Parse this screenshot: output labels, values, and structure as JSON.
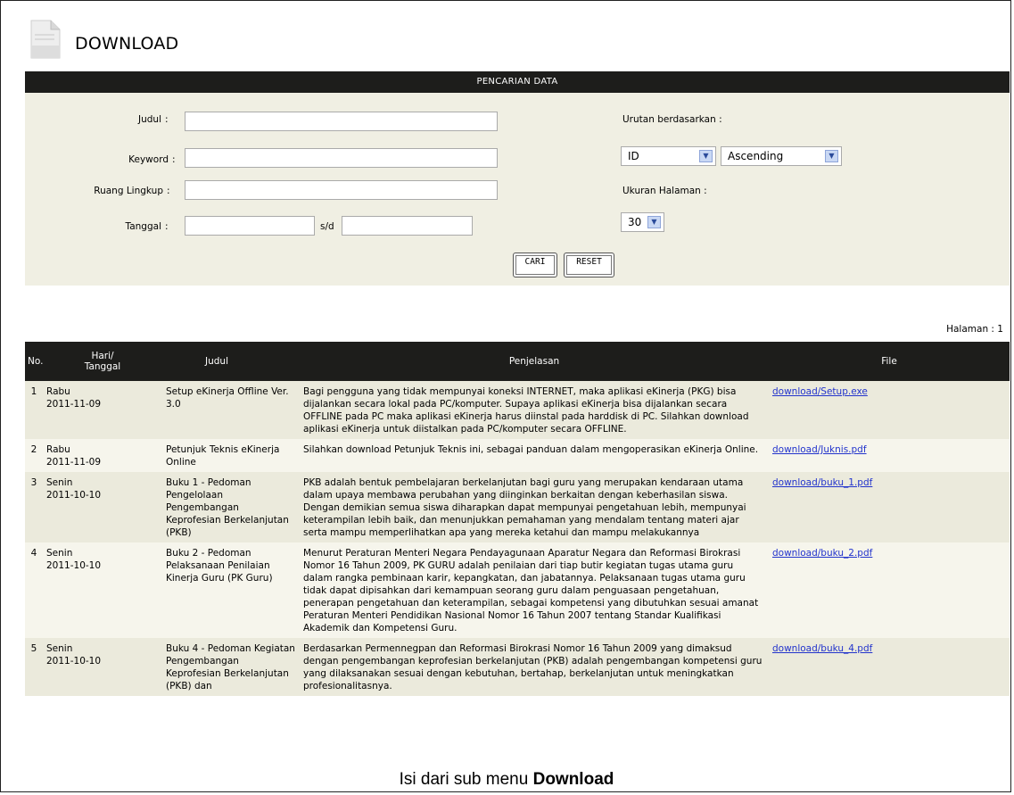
{
  "header": {
    "title": "DOWNLOAD",
    "icon": "document-icon"
  },
  "search": {
    "bar_title": "PENCARIAN DATA",
    "fields": [
      {
        "label": "Judul",
        "value": ""
      },
      {
        "label": "Keyword",
        "value": ""
      },
      {
        "label": "Ruang Lingkup",
        "value": ""
      },
      {
        "label": "Tanggal",
        "value": ""
      }
    ],
    "colon": ":",
    "date_sep": "s/d",
    "date_to_value": "",
    "sort_label": "Urutan berdasarkan :",
    "sort_field": "ID",
    "sort_order": "Ascending",
    "pagesize_label": "Ukuran Halaman :",
    "pagesize": "30",
    "search_button": "CARI",
    "reset_button": "RESET"
  },
  "pagination": {
    "label": "Halaman : 1"
  },
  "table": {
    "headers": {
      "no": "No.",
      "date_line1": "Hari/",
      "date_line2": "Tanggal",
      "title": "Judul",
      "desc": "Penjelasan",
      "file": "File"
    },
    "rows": [
      {
        "no": "1",
        "day": "Rabu",
        "date": "2011-11-09",
        "title": "Setup eKinerja Offline Ver. 3.0",
        "desc": "Bagi pengguna yang tidak mempunyai koneksi INTERNET, maka aplikasi eKinerja (PKG) bisa dijalankan secara lokal pada PC/komputer. Supaya aplikasi eKinerja bisa dijalankan secara OFFLINE pada PC maka aplikasi eKinerja harus diinstal pada harddisk di PC. Silahkan download aplikasi eKinerja untuk diistalkan pada PC/komputer secara OFFLINE.",
        "file": "download/Setup.exe"
      },
      {
        "no": "2",
        "day": "Rabu",
        "date": "2011-11-09",
        "title": "Petunjuk Teknis eKinerja Online",
        "desc": "Silahkan download Petunjuk Teknis ini, sebagai panduan dalam mengoperasikan eKinerja Online.",
        "file": "download/Juknis.pdf"
      },
      {
        "no": "3",
        "day": "Senin",
        "date": "2011-10-10",
        "title": "Buku 1 - Pedoman Pengelolaan Pengembangan Keprofesian Berkelanjutan (PKB)",
        "desc": "PKB adalah bentuk pembelajaran berkelanjutan bagi guru yang merupakan kendaraan utama dalam upaya membawa perubahan yang diinginkan berkaitan dengan keberhasilan siswa. Dengan demikian semua siswa diharapkan dapat mempunyai pengetahuan lebih, mempunyai keterampilan lebih baik, dan menunjukkan pemahaman yang mendalam tentang materi ajar serta mampu memperlihatkan apa yang mereka ketahui dan mampu melakukannya",
        "file": "download/buku_1.pdf"
      },
      {
        "no": "4",
        "day": "Senin",
        "date": "2011-10-10",
        "title": "Buku 2 - Pedoman Pelaksanaan Penilaian Kinerja Guru (PK Guru)",
        "desc": "Menurut Peraturan Menteri Negara Pendayagunaan Aparatur Negara dan Reformasi Birokrasi Nomor 16 Tahun 2009, PK GURU adalah penilaian dari tiap butir kegiatan tugas utama guru dalam rangka pembinaan karir, kepangkatan, dan jabatannya. Pelaksanaan tugas utama guru tidak dapat dipisahkan dari kemampuan seorang guru dalam penguasaan pengetahuan, penerapan pengetahuan dan keterampilan, sebagai kompetensi yang dibutuhkan sesuai amanat Peraturan Menteri Pendidikan Nasional Nomor 16 Tahun 2007 tentang Standar Kualifikasi Akademik dan Kompetensi Guru.",
        "file": "download/buku_2.pdf"
      },
      {
        "no": "5",
        "day": "Senin",
        "date": "2011-10-10",
        "title": "Buku 4 - Pedoman Kegiatan Pengembangan Keprofesian Berkelanjutan (PKB) dan",
        "desc": "Berdasarkan Permennegpan dan Reformasi Birokrasi Nomor 16 Tahun 2009 yang dimaksud dengan pengembangan keprofesian berkelanjutan (PKB) adalah pengembangan kompetensi guru yang dilaksanakan sesuai dengan kebutuhan, bertahap, berkelanjutan untuk meningkatkan profesionalitasnya.",
        "file": "download/buku_4.pdf"
      }
    ]
  },
  "caption": {
    "prefix": "Isi dari sub menu ",
    "bold": "Download"
  }
}
